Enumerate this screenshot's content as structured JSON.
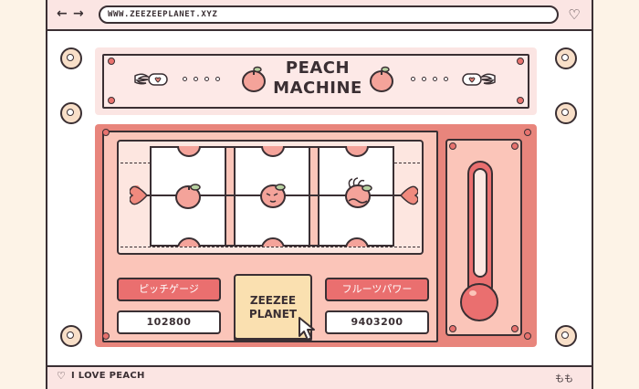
{
  "browser": {
    "url": "WWW.ZEEZEEPLANET.XYZ",
    "back_icon": "arrow-left-icon",
    "forward_icon": "arrow-right-icon",
    "favorite_icon": "heart-icon"
  },
  "header": {
    "title_line1": "PEACH",
    "title_line2": "MACHINE"
  },
  "machine": {
    "left_button_label": "ピッチゲージ",
    "left_value": "102800",
    "center_button_line1": "ZEEZEE",
    "center_button_line2": "PLANET",
    "right_button_label": "フルーツパワー",
    "right_value": "9403200",
    "reel_symbols": [
      "peach",
      "peach-face",
      "peach-bitten"
    ]
  },
  "footer": {
    "left_text": "I LOVE PEACH",
    "right_text": "もも"
  },
  "colors": {
    "background": "#fdf3e7",
    "panel_pink": "#fbe5e3",
    "machine_coral": "#e8857c",
    "button_red": "#ea6f6f",
    "peach": "#f4a39a",
    "center_button": "#fae0b0",
    "ink": "#3a2f33"
  }
}
